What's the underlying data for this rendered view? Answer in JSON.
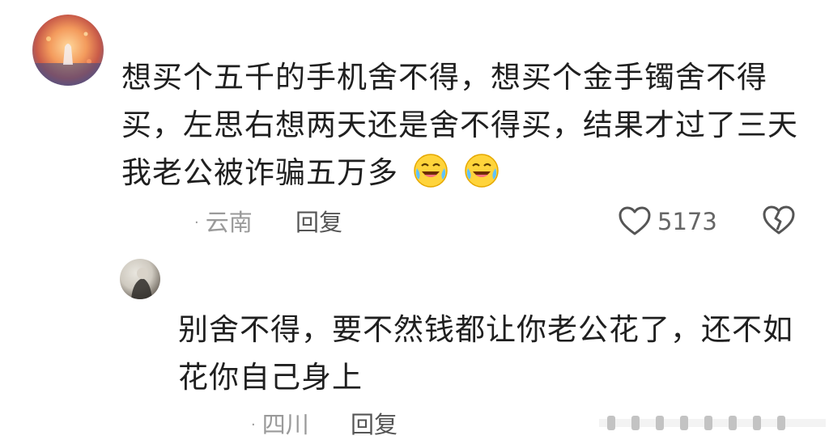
{
  "comment": {
    "text": "想买个五千的手机舍不得，想买个金手镯舍不得买，左思右想两天还是舍不得买，结果才过了三天我老公被诈骗五万多",
    "emojis": [
      "crying-laughing-emoji",
      "crying-laughing-emoji"
    ],
    "location": "云南",
    "reply_label": "回复",
    "likes": "5173",
    "icons": {
      "like": "heart-outline-icon",
      "dislike": "broken-heart-icon"
    }
  },
  "reply": {
    "text": "别舍不得，要不然钱都让你老公花了，还不如花你自己身上",
    "location": "四川",
    "reply_label": "回复"
  },
  "colors": {
    "text": "#1f1f1f",
    "meta": "#9a9a9a",
    "reply": "#555555"
  }
}
